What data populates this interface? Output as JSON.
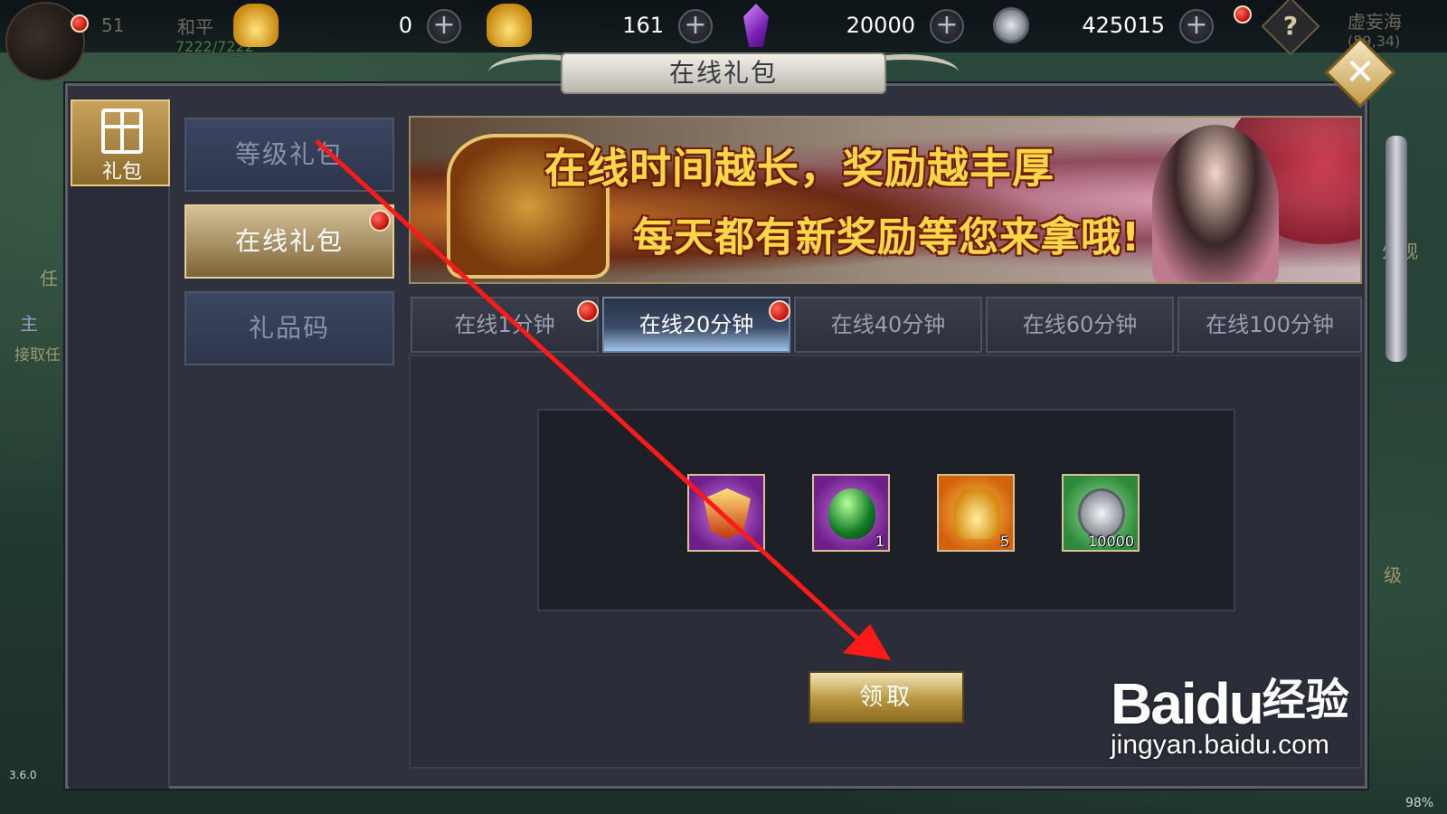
{
  "topbar": {
    "player_level": "51",
    "player_name": "和平",
    "hp": "7222/7222",
    "resources": [
      {
        "icon": "gold-ingot-icon",
        "value": "0"
      },
      {
        "icon": "gold-ingot-pile-icon",
        "value": "161"
      },
      {
        "icon": "purple-crystal-icon",
        "value": "20000"
      },
      {
        "icon": "silver-coin-icon",
        "value": "425015"
      }
    ],
    "location": "虚妄海",
    "location_coords": "(59,34)",
    "help_label": "?"
  },
  "panel": {
    "title": "在线礼包",
    "close_label": "✕",
    "gift_tab_label": "礼包",
    "menu": [
      {
        "label": "等级礼包",
        "active": false,
        "badge": false
      },
      {
        "label": "在线礼包",
        "active": true,
        "badge": true
      },
      {
        "label": "礼品码",
        "active": false,
        "badge": false
      }
    ],
    "banner": {
      "line1": "在线时间越长，奖励越丰厚",
      "line2": "每天都有新奖励等您来拿哦!"
    },
    "tabs": [
      {
        "label": "在线1分钟",
        "active": false,
        "badge": true
      },
      {
        "label": "在线20分钟",
        "active": true,
        "badge": true
      },
      {
        "label": "在线40分钟",
        "active": false,
        "badge": false
      },
      {
        "label": "在线60分钟",
        "active": false,
        "badge": false
      },
      {
        "label": "在线100分钟",
        "active": false,
        "badge": false
      }
    ],
    "rewards": [
      {
        "icon": "gift-shield-icon",
        "qty": ""
      },
      {
        "icon": "emerald-gem-icon",
        "qty": "1"
      },
      {
        "icon": "gold-ingot-icon",
        "qty": "5"
      },
      {
        "icon": "silver-coin-icon",
        "qty": "10000"
      }
    ],
    "claim_label": "领取"
  },
  "side_fragments": {
    "left_quest_tab": "任",
    "left_quest_main": "主",
    "left_quest_accept": "接取任",
    "right_view": "外观",
    "right_level": "级",
    "version": "3.6.0",
    "battery": "98%"
  },
  "watermark": {
    "brand": "Bai",
    "brand2": "du",
    "cn": "经验",
    "url": "jingyan.baidu.com"
  },
  "colors": {
    "accent_gold": "#d6c197",
    "annotation_red": "#ff1a1a",
    "badge_red": "#d4140c"
  }
}
